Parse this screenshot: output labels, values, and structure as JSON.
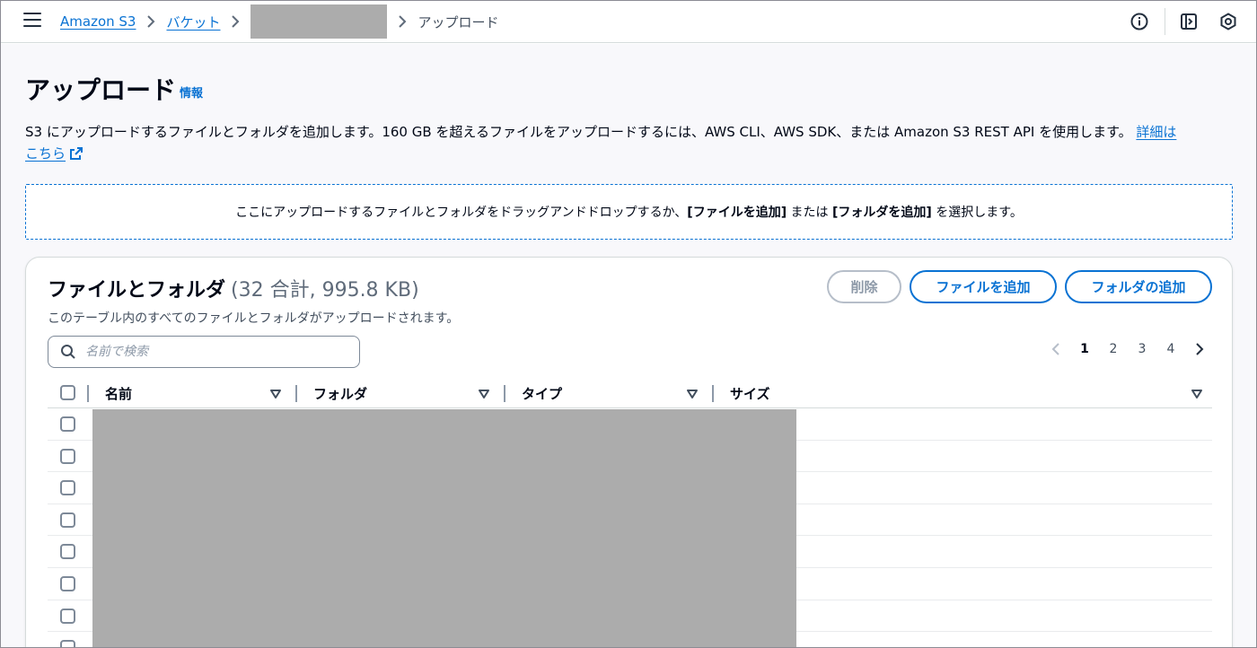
{
  "breadcrumb": {
    "items": [
      "Amazon S3",
      "バケット"
    ],
    "current": "アップロード"
  },
  "page": {
    "title": "アップロード",
    "info_label": "情報",
    "description": "S3 にアップロードするファイルとフォルダを追加します。160 GB を超えるファイルをアップロードするには、AWS CLI、AWS SDK、または Amazon S3 REST API を使用します。",
    "learn_more_part1": "詳細は",
    "learn_more_part2": "こちら"
  },
  "dropzone": {
    "text_prefix": "ここにアップロードするファイルとフォルダをドラッグアンドドロップするか、",
    "add_files": "[ファイルを追加]",
    "middle": " または ",
    "add_folder": "[フォルダを追加]",
    "text_suffix": " を選択します。"
  },
  "panel": {
    "title": "ファイルとフォルダ",
    "count": "(32 合計, 995.8 KB)",
    "description": "このテーブル内のすべてのファイルとフォルダがアップロードされます。",
    "delete_label": "削除",
    "add_files_label": "ファイルを追加",
    "add_folder_label": "フォルダの追加",
    "search_placeholder": "名前で検索"
  },
  "pagination": {
    "pages": [
      "1",
      "2",
      "3",
      "4"
    ],
    "current": "1"
  },
  "table": {
    "columns": [
      "名前",
      "フォルダ",
      "タイプ",
      "サイズ"
    ],
    "visible_rows": 8
  }
}
